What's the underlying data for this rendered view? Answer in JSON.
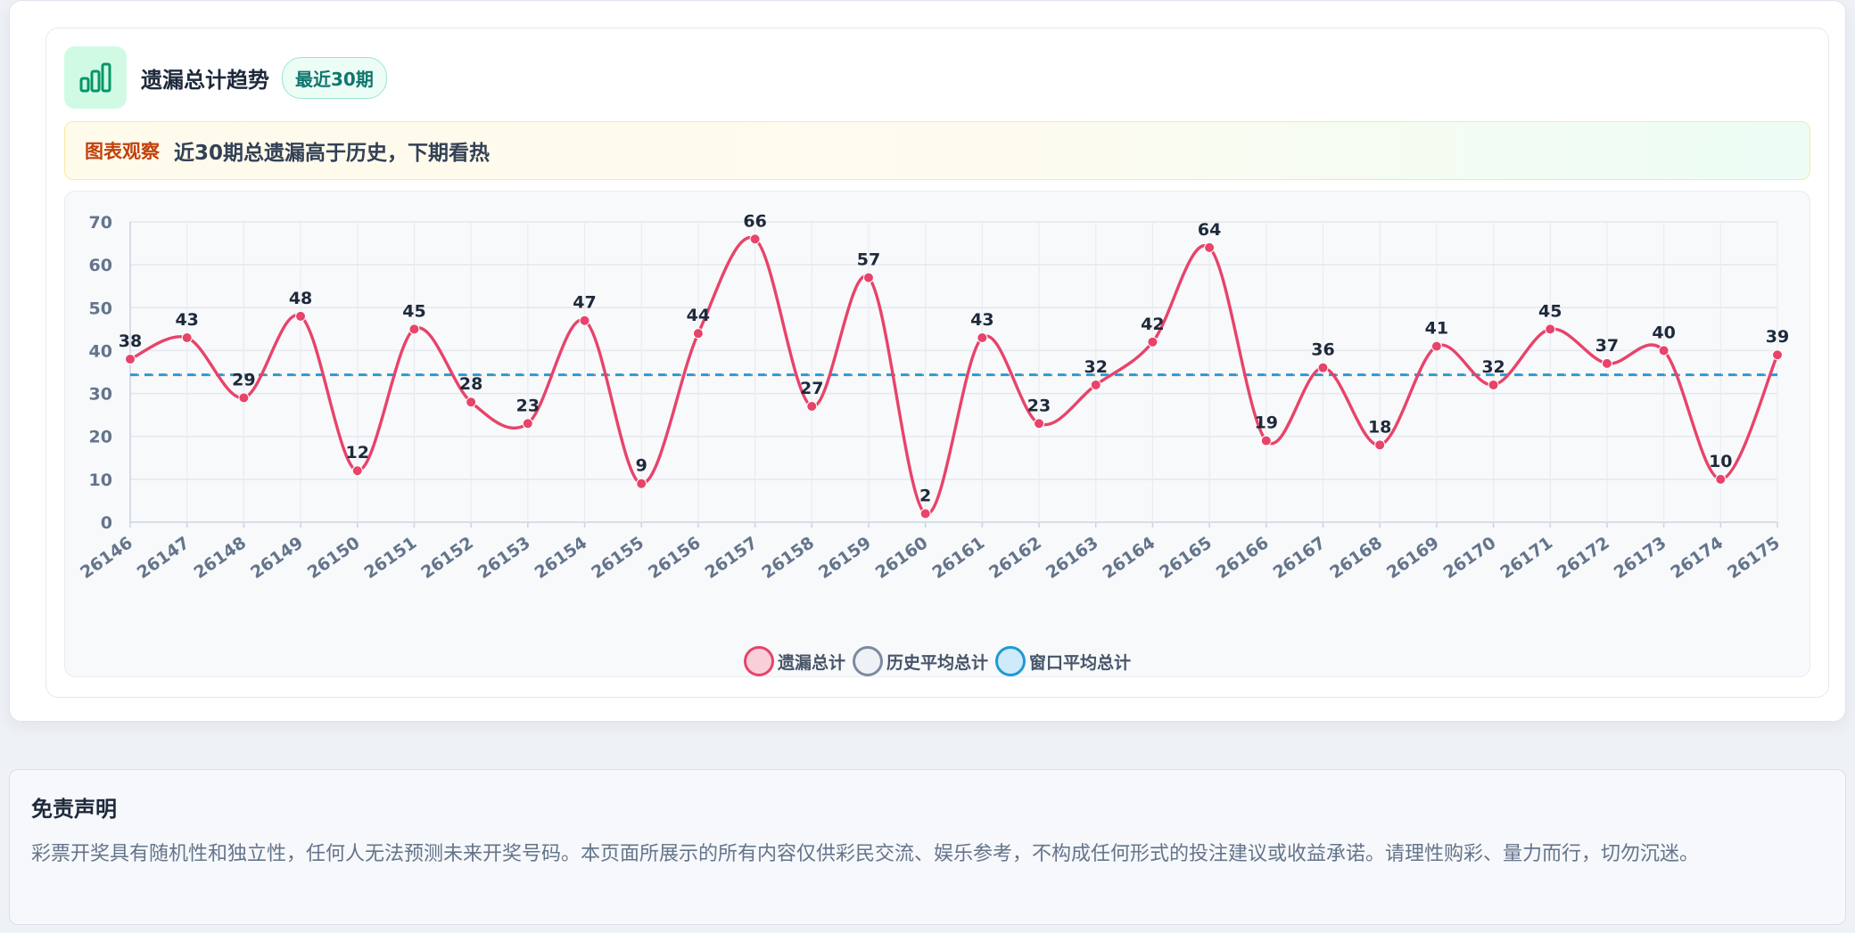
{
  "card": {
    "title": "遗漏总计趋势",
    "badge": "最近30期",
    "insight_label": "图表观察",
    "insight_text": "近30期总遗漏高于历史，下期看热"
  },
  "legend": [
    {
      "label": "遗漏总计",
      "fill": "#f9d0d9",
      "stroke": "#e8436a"
    },
    {
      "label": "历史平均总计",
      "fill": "#eef1f5",
      "stroke": "#7c8aa0"
    },
    {
      "label": "窗口平均总计",
      "fill": "#cfeaf8",
      "stroke": "#1d9ad6"
    }
  ],
  "chart_data": {
    "type": "line",
    "title": "",
    "xlabel": "",
    "ylabel": "",
    "ylim": [
      0,
      70
    ],
    "yticks": [
      0,
      10,
      20,
      30,
      40,
      50,
      60,
      70
    ],
    "grid": true,
    "legend_position": "bottom",
    "categories": [
      "26146",
      "26147",
      "26148",
      "26149",
      "26150",
      "26151",
      "26152",
      "26153",
      "26154",
      "26155",
      "26156",
      "26157",
      "26158",
      "26159",
      "26160",
      "26161",
      "26162",
      "26163",
      "26164",
      "26165",
      "26166",
      "26167",
      "26168",
      "26169",
      "26170",
      "26171",
      "26172",
      "26173",
      "26174",
      "26175"
    ],
    "series": [
      {
        "name": "遗漏总计",
        "color": "#e8436a",
        "values": [
          38,
          43,
          29,
          48,
          12,
          45,
          28,
          23,
          47,
          9,
          44,
          66,
          27,
          57,
          2,
          43,
          23,
          32,
          42,
          64,
          19,
          36,
          18,
          41,
          32,
          45,
          37,
          40,
          10,
          39
        ]
      },
      {
        "name": "历史平均总计",
        "color": "#7c8aa0",
        "values": [
          34.3,
          34.3,
          34.3,
          34.3,
          34.3,
          34.3,
          34.3,
          34.3,
          34.3,
          34.3,
          34.3,
          34.3,
          34.3,
          34.3,
          34.3,
          34.3,
          34.3,
          34.3,
          34.3,
          34.3,
          34.3,
          34.3,
          34.3,
          34.3,
          34.3,
          34.3,
          34.3,
          34.3,
          34.3,
          34.3
        ]
      },
      {
        "name": "窗口平均总计",
        "color": "#1d9ad6",
        "values": [
          34.4,
          34.4,
          34.4,
          34.4,
          34.4,
          34.4,
          34.4,
          34.4,
          34.4,
          34.4,
          34.4,
          34.4,
          34.4,
          34.4,
          34.4,
          34.4,
          34.4,
          34.4,
          34.4,
          34.4,
          34.4,
          34.4,
          34.4,
          34.4,
          34.4,
          34.4,
          34.4,
          34.4,
          34.4,
          34.4
        ]
      }
    ]
  },
  "disclaimer": {
    "title": "免责声明",
    "text": "彩票开奖具有随机性和独立性，任何人无法预测未来开奖号码。本页面所展示的所有内容仅供彩民交流、娱乐参考，不构成任何形式的投注建议或收益承诺。请理性购彩、量力而行，切勿沉迷。"
  }
}
